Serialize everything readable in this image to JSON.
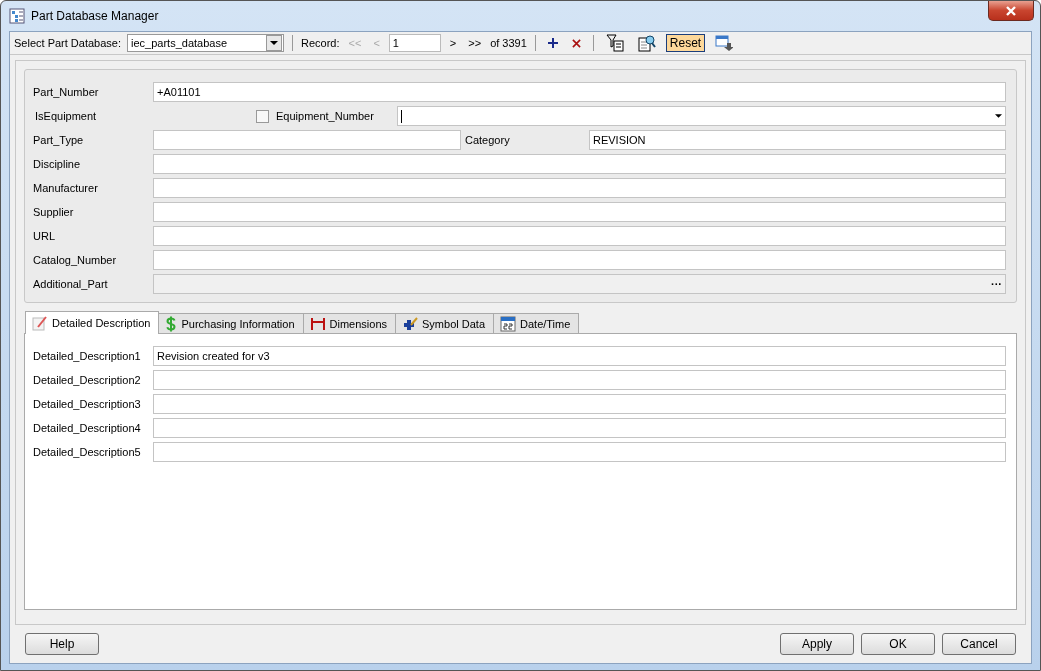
{
  "window": {
    "title": "Part Database Manager"
  },
  "toolbar": {
    "database_label": "Select Part Database:",
    "database": "iec_parts_database",
    "record_label": "Record:",
    "nav_back": [
      {
        "label": "<<",
        "disabled": true
      },
      {
        "label": "<",
        "disabled": true
      }
    ],
    "record": "1",
    "nav_forward": [
      {
        "label": ">",
        "disabled": false
      },
      {
        "label": ">>",
        "disabled": false
      }
    ],
    "record_count": "of 3391",
    "reset": "Reset"
  },
  "fields": [
    {
      "kind": "text",
      "label": "Part_Number",
      "value": "+A01101"
    },
    {
      "kind": "equipment",
      "label": "IsEquipment",
      "checked": false,
      "second_label": "Equipment_Number"
    },
    {
      "kind": "pair",
      "label": "Part_Type",
      "second_label": "Category",
      "second_value": "REVISION"
    },
    {
      "kind": "text",
      "label": "Discipline"
    },
    {
      "kind": "text",
      "label": "Manufacturer"
    },
    {
      "kind": "text",
      "label": "Supplier"
    },
    {
      "kind": "text",
      "label": "URL"
    },
    {
      "kind": "text",
      "label": "Catalog_Number"
    },
    {
      "kind": "browse",
      "label": "Additional_Part",
      "browse": "···"
    }
  ],
  "tabs": [
    {
      "label": "Detailed Description",
      "selected": true
    },
    {
      "label": "Purchasing Information",
      "selected": false
    },
    {
      "label": "Dimensions",
      "selected": false
    },
    {
      "label": "Symbol Data",
      "selected": false
    },
    {
      "label": "Date/Time",
      "selected": false
    }
  ],
  "descriptions": [
    {
      "label": "Detailed_Description1",
      "value": "Revision created for v3"
    },
    {
      "label": "Detailed_Description2"
    },
    {
      "label": "Detailed_Description3"
    },
    {
      "label": "Detailed_Description4"
    },
    {
      "label": "Detailed_Description5"
    }
  ],
  "buttons_left": [
    "Help"
  ],
  "buttons_right": [
    "Apply",
    "OK",
    "Cancel"
  ]
}
